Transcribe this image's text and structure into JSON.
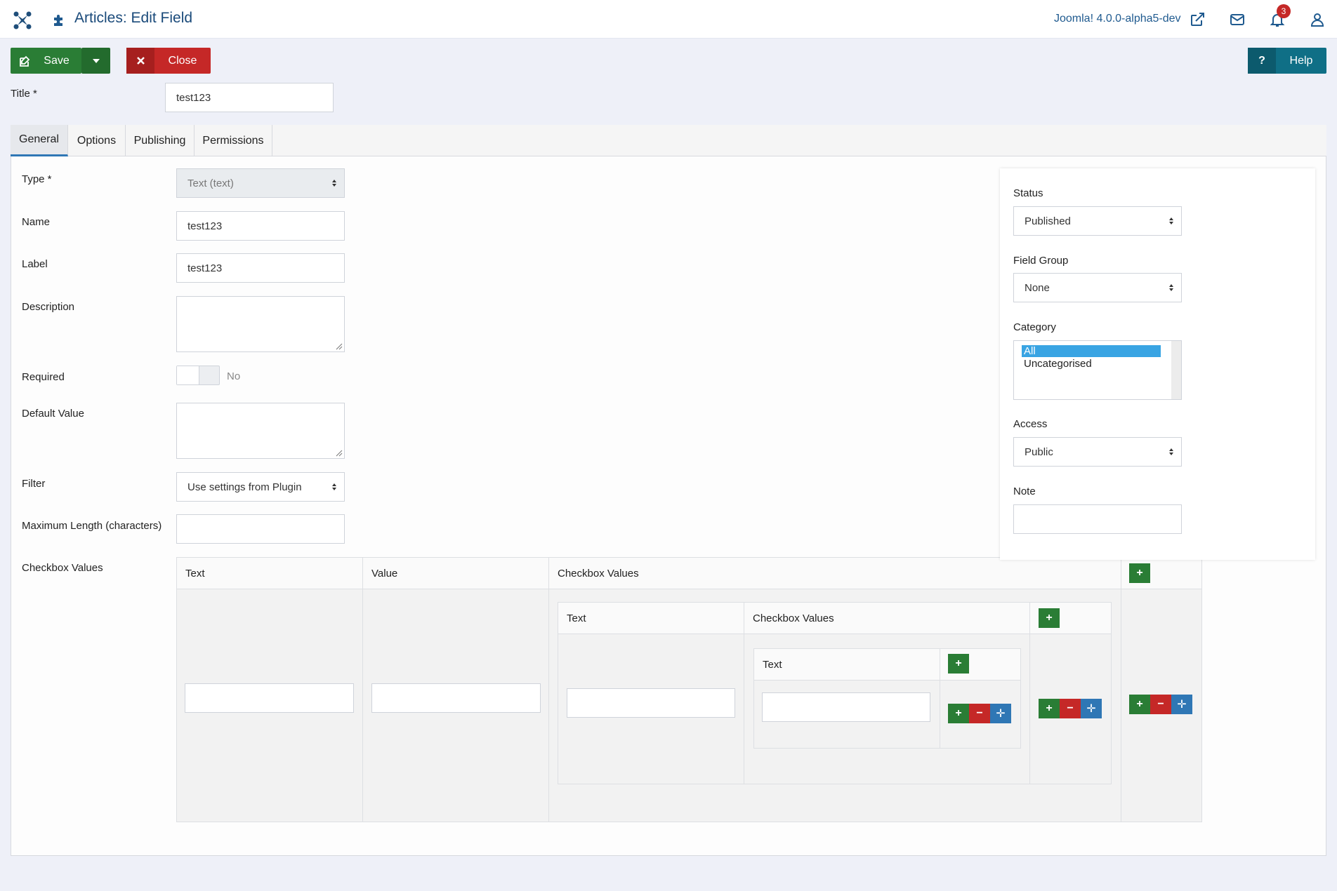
{
  "header": {
    "title": "Articles: Edit Field",
    "version": "Joomla! 4.0.0-alpha5-dev",
    "notifications_count": "3",
    "icons": [
      "joomla-logo-icon",
      "puzzle-icon",
      "external-link-icon",
      "envelope-icon",
      "bell-icon",
      "user-icon"
    ]
  },
  "toolbar": {
    "save_label": "Save",
    "close_label": "Close",
    "help_label": "Help",
    "help_icon_text": "?",
    "colors": {
      "save": "#2a7d35",
      "close": "#c52827",
      "help": "#0f6f86"
    }
  },
  "title_field": {
    "label": "Title *",
    "value": "test123"
  },
  "tabs": [
    "General",
    "Options",
    "Publishing",
    "Permissions"
  ],
  "active_tab": "General",
  "general": {
    "type": {
      "label": "Type *",
      "value": "Text (text)"
    },
    "name": {
      "label": "Name",
      "value": "test123"
    },
    "field_label": {
      "label": "Label",
      "value": "test123"
    },
    "description": {
      "label": "Description",
      "value": ""
    },
    "required": {
      "label": "Required",
      "value": "No"
    },
    "default_value": {
      "label": "Default Value",
      "value": ""
    },
    "filter": {
      "label": "Filter",
      "value": "Use settings from Plugin"
    },
    "max_length": {
      "label": "Maximum Length (characters)",
      "value": ""
    },
    "checkbox_values": {
      "label": "Checkbox Values"
    }
  },
  "subform": {
    "outer_headers": [
      "Text",
      "Value",
      "Checkbox Values"
    ],
    "middle_headers": [
      "Text",
      "Checkbox Values"
    ],
    "inner_headers": [
      "Text"
    ]
  },
  "sidebar": {
    "status": {
      "label": "Status",
      "value": "Published"
    },
    "field_group": {
      "label": "Field Group",
      "value": "None"
    },
    "category": {
      "label": "Category",
      "options": [
        "All",
        "Uncategorised"
      ],
      "selected": "All"
    },
    "access": {
      "label": "Access",
      "value": "Public"
    },
    "note": {
      "label": "Note",
      "value": ""
    }
  }
}
